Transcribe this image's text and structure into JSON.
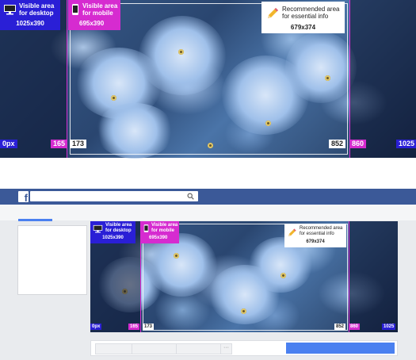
{
  "top_banner": {
    "desktop_label": [
      "Visible area",
      "for desktop",
      "1025x390"
    ],
    "mobile_label": [
      "Visible area",
      "for mobile",
      "695x390"
    ],
    "recommended_label": [
      "Recommended area",
      "for essential info",
      "679x374"
    ],
    "markers": {
      "m0": "0px",
      "m165": "165",
      "m173": "173",
      "m852": "852",
      "m860": "860",
      "m1025": "1025"
    }
  },
  "bottom_banner": {
    "desktop_label": [
      "Visible area",
      "for desktop",
      "1025x390"
    ],
    "mobile_label": [
      "Visible area",
      "for mobile",
      "695x390"
    ],
    "recommended_label": [
      "Recommended area",
      "for essential info",
      "679x374"
    ],
    "markers": {
      "m0": "0px",
      "m165": "165",
      "m173": "173",
      "m852": "852",
      "m860": "860",
      "m1025": "1025"
    }
  },
  "facebook_bar": {
    "logo": "f",
    "search_placeholder": ""
  },
  "colors": {
    "desktop": "#2a1fd6",
    "mobile": "#d62bd0",
    "fb_blue": "#3b5998",
    "button_blue": "#4a80f0"
  },
  "icons": {
    "desktop": "monitor-icon",
    "mobile": "phone-icon",
    "pencil": "pencil-icon",
    "search": "search-icon"
  }
}
